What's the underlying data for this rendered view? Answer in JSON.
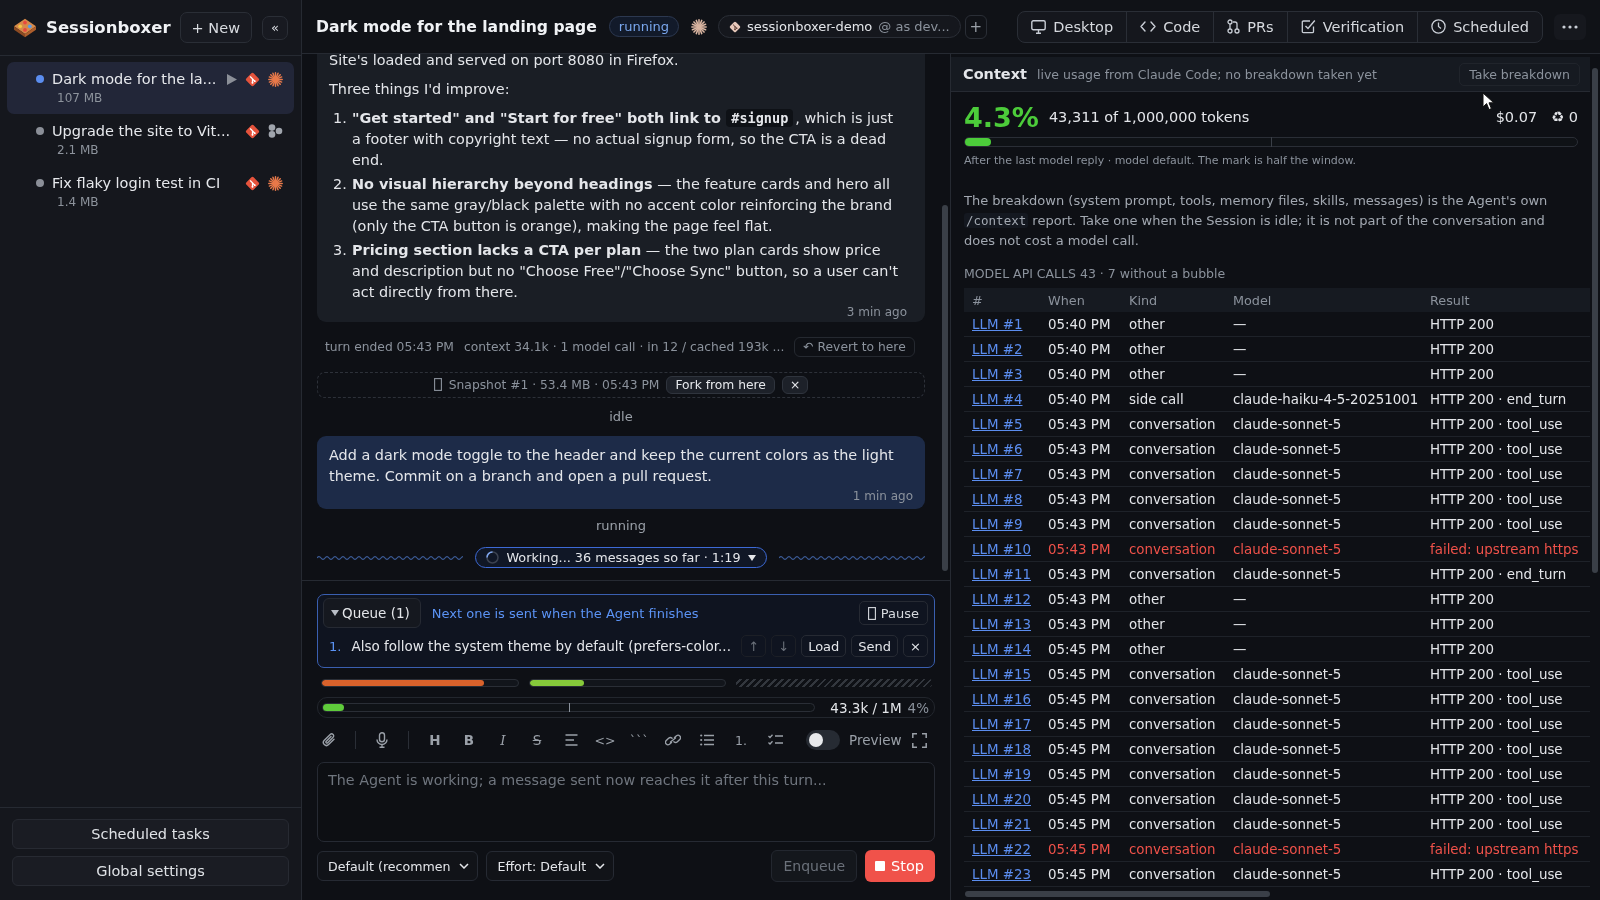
{
  "app": {
    "name": "Sessionboxer",
    "new_label": "+ New",
    "collapse_label": "«"
  },
  "sessions": [
    {
      "title": "Dark mode for the la...",
      "size": "107 MB",
      "color": "#5b8def",
      "selected": true,
      "running": true,
      "kind": "sparkle"
    },
    {
      "title": "Upgrade the site to Vit...",
      "size": "2.1 MB",
      "color": "#8b8f98",
      "selected": false,
      "running": false,
      "kind": "dots"
    },
    {
      "title": "Fix flaky login test in CI",
      "size": "1.4 MB",
      "color": "#8b8f98",
      "selected": false,
      "running": false,
      "kind": "sparkle"
    }
  ],
  "sidebar_footer": [
    "Scheduled tasks",
    "Global settings"
  ],
  "header": {
    "title": "Dark mode for the landing page",
    "status": "running",
    "repo": "sessionboxer-demo",
    "account": "@ as dev...",
    "add_label": "+",
    "views": [
      {
        "kind": "desktop",
        "label": "Desktop",
        "selected": false
      },
      {
        "kind": "code",
        "label": "Code",
        "selected": false
      },
      {
        "kind": "prs",
        "label": "PRs",
        "selected": false
      },
      {
        "kind": "verification",
        "label": "Verification",
        "selected": false
      },
      {
        "kind": "scheduled",
        "label": "Scheduled",
        "selected": false
      }
    ]
  },
  "chat": [
    {
      "kind": "agent",
      "paragraphs": [
        "Site's loaded and served on port 8080 in Firefox.",
        "Three things I'd improve:"
      ],
      "list": [
        {
          "number": "1.",
          "text": "**\"Get started\" and \"Start for free\" both link to** ",
          "code": "#signup",
          "after": ", which is just a footer with copyright text — no actual signup form, so the CTA is a dead end."
        },
        {
          "number": "2.",
          "text": "**No visual hierarchy beyond headings** — the feature cards and hero all use the same gray/black palette with no accent color reinforcing the brand (only the CTA button is orange), making the page feel flat."
        },
        {
          "number": "3.",
          "text": "**Pricing section lacks a CTA per plan** — the two plan cards show price and description but no \"Choose Free\"/\"Choose Sync\" button, so a user can't act directly from there."
        }
      ],
      "time": "3 min ago"
    },
    {
      "kind": "turn",
      "label": "turn ended 05:43 PM",
      "detail": "context 34.1k · 1 model call · in 12 / cached 193k ...",
      "action": "↶ Revert to here"
    },
    {
      "kind": "snapshot",
      "label": "Snapshot #1 · 53.4 MB · 05:43 PM",
      "action": "Fork from here",
      "close": "×"
    },
    {
      "kind": "status",
      "label": "idle"
    },
    {
      "kind": "user",
      "text": "Add a dark mode toggle to the header and keep the current colors as the light theme. Commit on a branch and open a pull request.",
      "time": "1 min ago"
    },
    {
      "kind": "status",
      "label": "running"
    },
    {
      "kind": "working",
      "label": "Working... 36 messages so far · 1:19"
    }
  ],
  "queue": {
    "label": "Queue (1)",
    "expanded": true,
    "note": "Next one is sent when the Agent finishes",
    "pause": "Pause",
    "items": [
      {
        "number": "1.",
        "text": "Also follow the system theme by default (prefers-color...",
        "actions": [
          {
            "label": "↑",
            "disabled": true
          },
          {
            "label": "↓",
            "disabled": true
          },
          {
            "label": "Load",
            "disabled": false
          },
          {
            "label": "Send",
            "disabled": false
          },
          {
            "label": "×",
            "disabled": false
          }
        ]
      }
    ]
  },
  "meters": [
    {
      "kind": "bar",
      "level": 0.83,
      "color": "#d9622b"
    },
    {
      "kind": "bar",
      "level": 0.28,
      "color": "#86c93a"
    },
    {
      "kind": "hatched"
    }
  ],
  "context_bar": {
    "level": 0.043,
    "reading": "43.3k / 1M",
    "percent": "4%"
  },
  "toolbar": [
    {
      "kind": "attach"
    },
    {
      "kind": "separator"
    },
    {
      "kind": "mic"
    },
    {
      "kind": "separator"
    },
    {
      "kind": "heading",
      "glyph": "H"
    },
    {
      "kind": "bold",
      "glyph": "B"
    },
    {
      "kind": "italic",
      "glyph": "I"
    },
    {
      "kind": "strike",
      "glyph": "S"
    },
    {
      "kind": "align"
    },
    {
      "kind": "code",
      "glyph": "<>"
    },
    {
      "kind": "codeblock",
      "glyph": "```"
    },
    {
      "kind": "link"
    },
    {
      "kind": "bullets"
    },
    {
      "kind": "numbered",
      "glyph": "1."
    },
    {
      "kind": "checklist"
    }
  ],
  "preview": {
    "label": "Preview",
    "on": false
  },
  "composer": {
    "placeholder": "The Agent is working; a message sent now reaches it after this turn..."
  },
  "controls": {
    "model": "Default (recommen",
    "effort": "Effort: Default",
    "enqueue": {
      "label": "Enqueue",
      "disabled": true
    },
    "stop": "Stop"
  },
  "context": {
    "title": "Context",
    "subtitle": "live usage from Claude Code; no breakdown taken yet",
    "action": "Take breakdown",
    "percent": "4.3%",
    "tokens": "43,311 of 1,000,000 tokens",
    "cost": "$0.07",
    "cache": "♻ 0",
    "level": 0.043,
    "caption": "After the last model reply · model default. The mark is half the window.",
    "note_before": "The breakdown (system prompt, tools, memory files, skills, messages) is the Agent's own ",
    "note_code": "/context",
    "note_after": " report. Take one when the Session is idle; it is not part of the conversation and does not cost a model call.",
    "calls_heading": "MODEL API CALLS 43 · 7 without a bubble"
  },
  "table": {
    "columns": [
      "#",
      "When",
      "Kind",
      "Model",
      "Result"
    ],
    "rows": [
      {
        "cells": [
          "LLM #1",
          "05:40 PM",
          "other",
          "—",
          "HTTP 200"
        ],
        "failed": false
      },
      {
        "cells": [
          "LLM #2",
          "05:40 PM",
          "other",
          "—",
          "HTTP 200"
        ],
        "failed": false
      },
      {
        "cells": [
          "LLM #3",
          "05:40 PM",
          "other",
          "—",
          "HTTP 200"
        ],
        "failed": false
      },
      {
        "cells": [
          "LLM #4",
          "05:40 PM",
          "side call",
          "claude-haiku-4-5-20251001",
          "HTTP 200 · end_turn"
        ],
        "failed": false
      },
      {
        "cells": [
          "LLM #5",
          "05:43 PM",
          "conversation",
          "claude-sonnet-5",
          "HTTP 200 · tool_use"
        ],
        "failed": false
      },
      {
        "cells": [
          "LLM #6",
          "05:43 PM",
          "conversation",
          "claude-sonnet-5",
          "HTTP 200 · tool_use"
        ],
        "failed": false
      },
      {
        "cells": [
          "LLM #7",
          "05:43 PM",
          "conversation",
          "claude-sonnet-5",
          "HTTP 200 · tool_use"
        ],
        "failed": false
      },
      {
        "cells": [
          "LLM #8",
          "05:43 PM",
          "conversation",
          "claude-sonnet-5",
          "HTTP 200 · tool_use"
        ],
        "failed": false
      },
      {
        "cells": [
          "LLM #9",
          "05:43 PM",
          "conversation",
          "claude-sonnet-5",
          "HTTP 200 · tool_use"
        ],
        "failed": false
      },
      {
        "cells": [
          "LLM #10",
          "05:43 PM",
          "conversation",
          "claude-sonnet-5",
          "failed: upstream https"
        ],
        "failed": true
      },
      {
        "cells": [
          "LLM #11",
          "05:43 PM",
          "conversation",
          "claude-sonnet-5",
          "HTTP 200 · end_turn"
        ],
        "failed": false
      },
      {
        "cells": [
          "LLM #12",
          "05:43 PM",
          "other",
          "—",
          "HTTP 200"
        ],
        "failed": false
      },
      {
        "cells": [
          "LLM #13",
          "05:43 PM",
          "other",
          "—",
          "HTTP 200"
        ],
        "failed": false
      },
      {
        "cells": [
          "LLM #14",
          "05:45 PM",
          "other",
          "—",
          "HTTP 200"
        ],
        "failed": false
      },
      {
        "cells": [
          "LLM #15",
          "05:45 PM",
          "conversation",
          "claude-sonnet-5",
          "HTTP 200 · tool_use"
        ],
        "failed": false
      },
      {
        "cells": [
          "LLM #16",
          "05:45 PM",
          "conversation",
          "claude-sonnet-5",
          "HTTP 200 · tool_use"
        ],
        "failed": false
      },
      {
        "cells": [
          "LLM #17",
          "05:45 PM",
          "conversation",
          "claude-sonnet-5",
          "HTTP 200 · tool_use"
        ],
        "failed": false
      },
      {
        "cells": [
          "LLM #18",
          "05:45 PM",
          "conversation",
          "claude-sonnet-5",
          "HTTP 200 · tool_use"
        ],
        "failed": false
      },
      {
        "cells": [
          "LLM #19",
          "05:45 PM",
          "conversation",
          "claude-sonnet-5",
          "HTTP 200 · tool_use"
        ],
        "failed": false
      },
      {
        "cells": [
          "LLM #20",
          "05:45 PM",
          "conversation",
          "claude-sonnet-5",
          "HTTP 200 · tool_use"
        ],
        "failed": false
      },
      {
        "cells": [
          "LLM #21",
          "05:45 PM",
          "conversation",
          "claude-sonnet-5",
          "HTTP 200 · tool_use"
        ],
        "failed": false
      },
      {
        "cells": [
          "LLM #22",
          "05:45 PM",
          "conversation",
          "claude-sonnet-5",
          "failed: upstream https"
        ],
        "failed": true
      },
      {
        "cells": [
          "LLM #23",
          "05:45 PM",
          "conversation",
          "claude-sonnet-5",
          "HTTP 200 · tool_use"
        ],
        "failed": false
      }
    ]
  }
}
